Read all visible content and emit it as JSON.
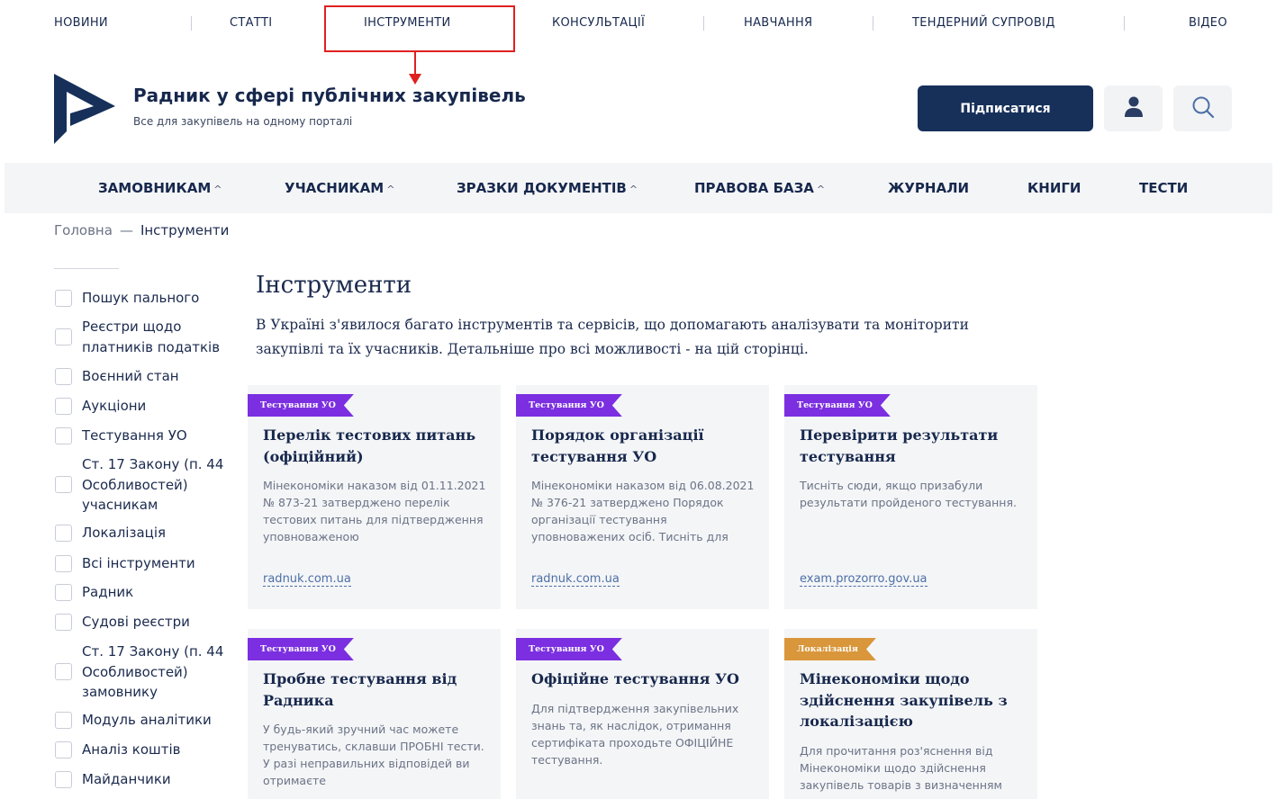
{
  "top_nav": {
    "items": [
      "НОВИНИ",
      "СТАТТІ",
      "ІНСТРУМЕНТИ",
      "КОНСУЛЬТАЦІЇ",
      "НАВЧАННЯ",
      "ТЕНДЕРНИЙ СУПРОВІД",
      "ВІДЕО"
    ],
    "highlighted_item": "ІНСТРУМЕНТИ",
    "highlight_color": "#e02020"
  },
  "header": {
    "title": "Радник у сфері публічних закупівель",
    "subtitle": "Все для закупівель на одному порталі",
    "subscribe_label": "Підписатися",
    "user_icon": "user-icon",
    "search_icon": "search-icon",
    "brand_color": "#16305a"
  },
  "main_nav": {
    "items": [
      {
        "label": "ЗАМОВНИКАМ",
        "has_dropdown": true
      },
      {
        "label": "УЧАСНИКАМ",
        "has_dropdown": true
      },
      {
        "label": "ЗРАЗКИ ДОКУМЕНТІВ",
        "has_dropdown": true
      },
      {
        "label": "ПРАВОВА БАЗА",
        "has_dropdown": true
      },
      {
        "label": "ЖУРНАЛИ",
        "has_dropdown": false
      },
      {
        "label": "КНИГИ",
        "has_dropdown": false
      },
      {
        "label": "ТЕСТИ",
        "has_dropdown": false
      }
    ]
  },
  "breadcrumb": {
    "home": "Головна",
    "separator": "—",
    "current": "Інструменти"
  },
  "sidebar": {
    "filters": [
      "Пошук пального",
      "Реєстри щодо платників податків",
      "Воєнний стан",
      "Аукціони",
      "Тестування УО",
      "Ст. 17 Закону (п. 44 Особливостей) учасникам",
      "Локалізація",
      "Всі інструменти",
      "Радник",
      "Судові реєстри",
      "Ст. 17 Закону (п. 44 Особливостей) замовнику",
      "Модуль аналітики",
      "Аналіз коштів",
      "Майданчики"
    ]
  },
  "main": {
    "title": "Інструменти",
    "intro": "В Україні з'явилося багато інструментів та сервісів, що допомагають аналізувати та моніторити закупівлі та їх учасників. Детальніше про всі можливості - на цій сторінці.",
    "cards": [
      {
        "tag": "Тестування УО",
        "tag_color": "#7b2fe0",
        "title": "Перелік тестових питань (офіційний)",
        "description": "Мінекономіки наказом від 01.11.2021 № 873-21 затверджено перелік тестових питань для підтвердження уповноваженою",
        "link": "radnuk.com.ua"
      },
      {
        "tag": "Тестування УО",
        "tag_color": "#7b2fe0",
        "title": "Порядок організації тестування УО",
        "description": "Мінекономіки наказом від 06.08.2021 № 376-21 затверджено Порядок організації тестування уповноважених осіб. Тисніть для",
        "link": "radnuk.com.ua"
      },
      {
        "tag": "Тестування УО",
        "tag_color": "#7b2fe0",
        "title": "Перевірити результати тестування",
        "description": "Тисніть сюди, якщо призабули результати пройденого тестування.",
        "link": "exam.prozorro.gov.ua"
      },
      {
        "tag": "Тестування УО",
        "tag_color": "#7b2fe0",
        "title": "Пробне тестування від Радника",
        "description": "У будь-який зручний час можете тренуватись, склавши ПРОБНІ тести. У разі неправильних відповідей ви отримаєте",
        "link": ""
      },
      {
        "tag": "Тестування УО",
        "tag_color": "#7b2fe0",
        "title": "Офіційне тестування УО",
        "description": "Для підтвердження закупівельних знань та, як наслідок, отримання сертифіката проходьте ОФІЦІЙНЕ тестування.",
        "link": ""
      },
      {
        "tag": "Локалізація",
        "tag_color": "#d9963a",
        "title": "Мінекономіки щодо здійснення закупівель з локалізацією",
        "description": "Для прочитання роз'яснення від Мінекономіки щодо здійснення закупівель товарів з визначенням",
        "link": ""
      }
    ]
  }
}
